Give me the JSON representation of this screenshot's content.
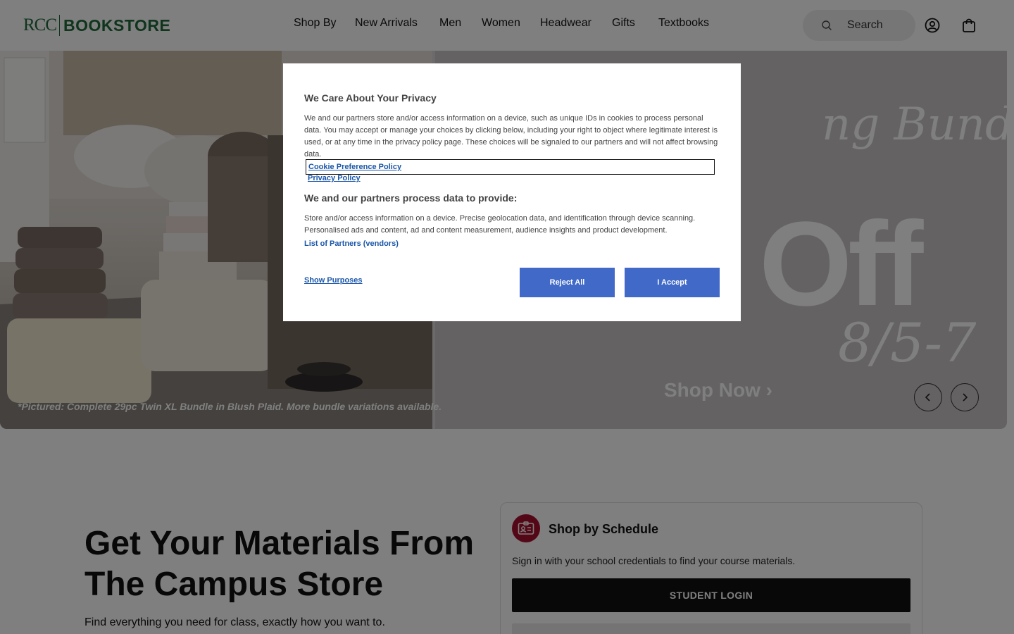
{
  "header": {
    "logo_rcc": "RCC",
    "logo_text": "BOOKSTORE",
    "nav": [
      {
        "label": "Shop By"
      },
      {
        "label": "New Arrivals"
      },
      {
        "label": "Men"
      },
      {
        "label": "Women"
      },
      {
        "label": "Headwear"
      },
      {
        "label": "Gifts"
      },
      {
        "label": "Textbooks"
      }
    ],
    "search_placeholder": "Search"
  },
  "hero": {
    "caption": "*Pictured: Complete 29pc Twin XL Bundle in Blush Plaid. More bundle variations available.",
    "headline_partial": "ng Bundles",
    "discount_partial": "Off",
    "dates_partial": "8/5-7",
    "shop_now": "Shop Now ›"
  },
  "lower": {
    "title": "Get Your Materials From The Campus Store",
    "subtitle": "Find everything you need for class, exactly how you want to."
  },
  "schedule_card": {
    "title": "Shop by Schedule",
    "description": "Sign in with your school credentials to find your course materials.",
    "button": "STUDENT LOGIN"
  },
  "privacy_modal": {
    "title": "We Care About Your Privacy",
    "body": "We and our partners store and/or access information on a device, such as unique IDs in cookies to process personal data. You may accept or manage your choices by clicking below, including your right to object where legitimate interest is used, or at any time in the privacy policy page. These choices will be signaled to our partners and will not affect browsing data.",
    "cookie_policy_link": "Cookie Preference Policy",
    "privacy_policy_link": "Privacy Policy",
    "subheading": "We and our partners process data to provide:",
    "purposes": "Store and/or access information on a device. Precise geolocation data, and identification through device scanning. Personalised ads and content, ad and content measurement, audience insights and product development.",
    "partners_link": "List of Partners (vendors)",
    "show_purposes": "Show Purposes",
    "reject_all": "Reject All",
    "accept": "I Accept"
  },
  "colors": {
    "brand_green": "#1f6b3a",
    "modal_button_blue": "#4169c7",
    "link_blue": "#1a56a8",
    "badge_red": "#a8102e"
  }
}
